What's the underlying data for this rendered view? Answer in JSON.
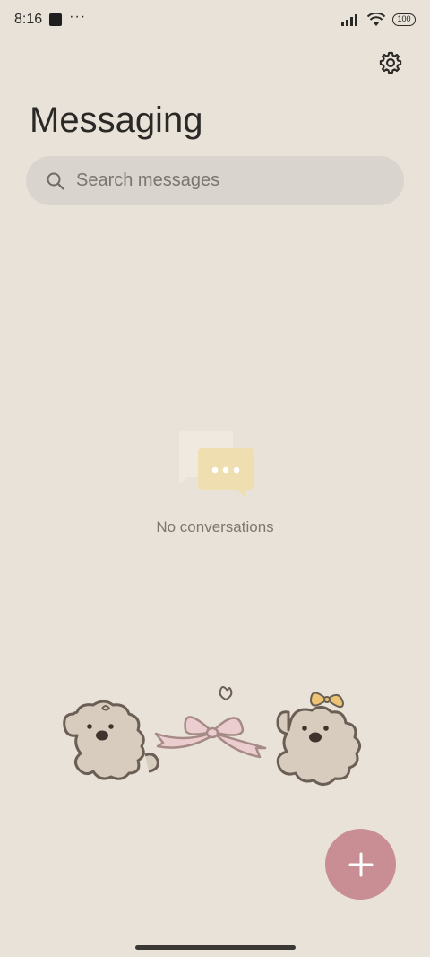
{
  "status_bar": {
    "time": "8:16",
    "overflow": "···",
    "battery": "100",
    "icons": [
      "notification-square-icon",
      "signal-icon",
      "wifi-icon",
      "battery-icon"
    ]
  },
  "header": {
    "title": "Messaging",
    "settings_icon": "gear-icon"
  },
  "search": {
    "placeholder": "Search messages",
    "icon": "search-icon"
  },
  "empty_state": {
    "text": "No conversations",
    "icon": "chat-bubbles-icon"
  },
  "fab": {
    "icon": "plus-icon"
  },
  "colors": {
    "background": "#e8e2d9",
    "search_bg": "#d9d4cd",
    "fab": "#c98e93",
    "bubble_back": "#efe9df",
    "bubble_front": "#efdfb0"
  }
}
